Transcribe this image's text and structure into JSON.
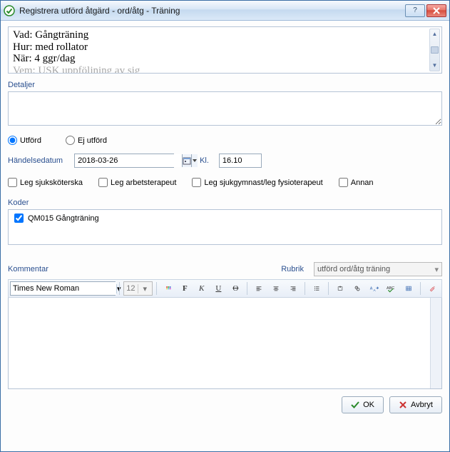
{
  "window": {
    "title": "Registrera utförd åtgärd - ord/åtg - Träning"
  },
  "order_lines": [
    "Vad: Gångträning",
    "Hur: med rollator",
    "När: 4 ggr/dag",
    "Vem: USK   uppföljning av sig"
  ],
  "labels": {
    "detaljer": "Detaljer",
    "utford": "Utförd",
    "ej_utford": "Ej utförd",
    "handelsedatum": "Händelsedatum",
    "kl": "Kl.",
    "leg_ssk": "Leg sjuksköterska",
    "leg_arb": "Leg arbetsterapeut",
    "leg_sjukg": "Leg sjukgymnast/leg fysioterapeut",
    "annan": "Annan",
    "koder": "Koder",
    "kommentar": "Kommentar",
    "rubrik": "Rubrik"
  },
  "values": {
    "handelsedatum": "2018-03-26",
    "kl": "16.10",
    "utford_selected": true,
    "ej_utford_selected": false,
    "rubrik_selected": "utförd ord/åtg träning",
    "font_name": "Times New Roman",
    "font_size": "12"
  },
  "koder": [
    {
      "checked": true,
      "label": "QM015 Gångträning"
    }
  ],
  "footer": {
    "ok": "OK",
    "avbryt": "Avbryt"
  }
}
